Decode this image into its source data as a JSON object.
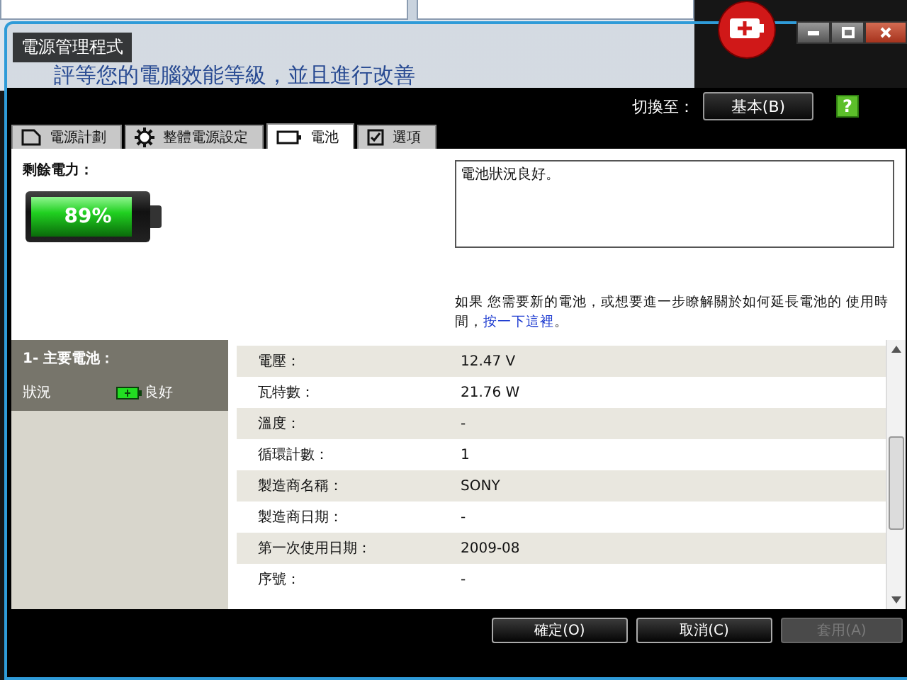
{
  "background_window": {
    "heading": "評等您的電腦效能等級，並且進行改善"
  },
  "window": {
    "title": "電源管理程式"
  },
  "toolbar": {
    "switch_label": "切換至：",
    "switch_button": "基本(B)",
    "help": "?"
  },
  "tabs": [
    {
      "label": "電源計劃",
      "kind": "plan",
      "selected": false
    },
    {
      "label": "整體電源設定",
      "kind": "gear",
      "selected": false
    },
    {
      "label": "電池",
      "kind": "battery",
      "selected": true
    },
    {
      "label": "選項",
      "kind": "check",
      "selected": false
    }
  ],
  "remaining_power": {
    "label": "剩餘電力：",
    "level": 0.89,
    "reading": "89%"
  },
  "status_message": "電池狀況良好。",
  "info": {
    "text": "如果 您需要新的電池，或想要進一步瞭解關於如何延長電池的 使用時間，",
    "link": "按一下這裡",
    "end": "。"
  },
  "batteries": [
    {
      "title": "1- 主要電池：",
      "status_label": "狀況",
      "status": "良好",
      "selected": true
    }
  ],
  "details": [
    {
      "label": "電壓：",
      "value": "12.47 V"
    },
    {
      "label": "瓦特數：",
      "value": "21.76 W"
    },
    {
      "label": "溫度：",
      "value": "-"
    },
    {
      "label": "循環計數：",
      "value": "1"
    },
    {
      "label": "製造商名稱：",
      "value": "SONY"
    },
    {
      "label": "製造商日期：",
      "value": "-"
    },
    {
      "label": "第一次使用日期：",
      "value": "2009-08"
    },
    {
      "label": "序號：",
      "value": "-"
    }
  ],
  "buttons": [
    {
      "label": "確定(O)",
      "disabled": false
    },
    {
      "label": "取消(C)",
      "disabled": false
    },
    {
      "label": "套用(A)",
      "disabled": true
    }
  ]
}
